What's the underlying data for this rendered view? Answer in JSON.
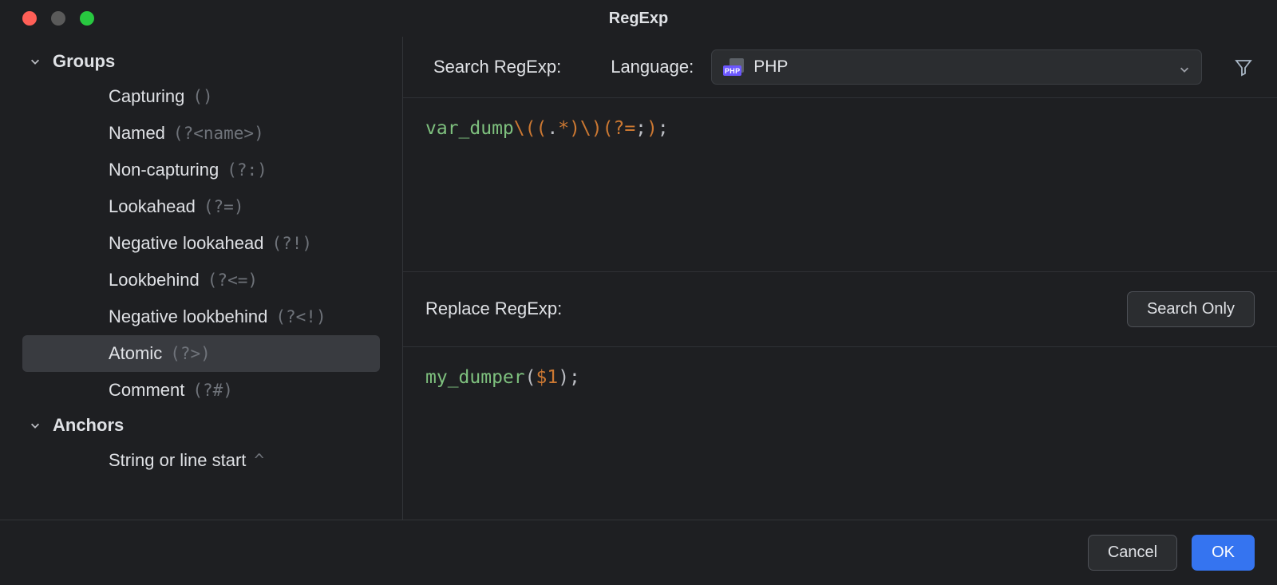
{
  "window": {
    "title": "RegExp"
  },
  "sidebar": {
    "groups": {
      "label": "Groups",
      "items": [
        {
          "label": "Capturing",
          "hint": "()"
        },
        {
          "label": "Named",
          "hint": "(?<name>)"
        },
        {
          "label": "Non-capturing",
          "hint": "(?:)"
        },
        {
          "label": "Lookahead",
          "hint": "(?=)"
        },
        {
          "label": "Negative lookahead",
          "hint": "(?!)"
        },
        {
          "label": "Lookbehind",
          "hint": "(?<=)"
        },
        {
          "label": "Negative lookbehind",
          "hint": "(?<!)"
        },
        {
          "label": "Atomic",
          "hint": "(?>)"
        },
        {
          "label": "Comment",
          "hint": "(?#)"
        }
      ]
    },
    "anchors": {
      "label": "Anchors",
      "items": [
        {
          "label": "String or line start",
          "hint": "^"
        }
      ]
    }
  },
  "toolbar": {
    "search_label": "Search RegExp:",
    "language_label": "Language:",
    "language_value": "PHP",
    "php_chip": "PHP"
  },
  "search_editor": {
    "tokens": {
      "fn": "var_dump",
      "esc1": "\\(",
      "grp_open": "(",
      "dot": ".",
      "star": "*",
      "grp_close": ")",
      "esc2": "\\)",
      "la_open": "(?=",
      "semi": ";",
      "la_close": ")",
      "trail": ";"
    },
    "raw": "var_dump\\((.*)\\)(?=;);"
  },
  "replace": {
    "label": "Replace RegExp:",
    "search_only": "Search Only"
  },
  "replace_editor": {
    "tokens": {
      "id": "my_dumper",
      "open": "(",
      "var": "$1",
      "close": ")",
      "semi": ";"
    },
    "raw": "my_dumper($1);"
  },
  "footer": {
    "cancel": "Cancel",
    "ok": "OK"
  }
}
